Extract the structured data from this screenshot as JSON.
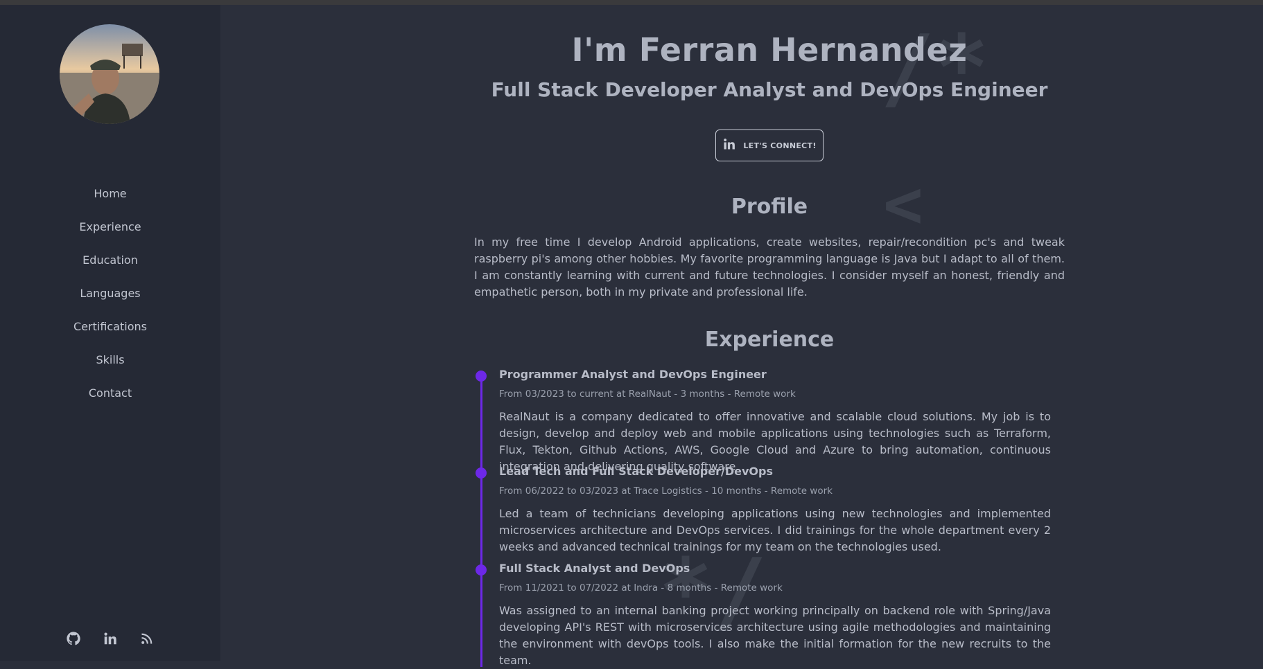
{
  "sidebar": {
    "avatar_alt": "profile photo",
    "nav": [
      "Home",
      "Experience",
      "Education",
      "Languages",
      "Certifications",
      "Skills",
      "Contact"
    ],
    "social_icons": [
      "github-icon",
      "linkedin-icon",
      "rss-icon"
    ]
  },
  "header": {
    "title": "I'm Ferran Hernandez",
    "subtitle": "Full Stack Developer Analyst and DevOps Engineer",
    "connect_label": "LET'S CONNECT!"
  },
  "decorations": {
    "comment_open": "/*",
    "angle": "<",
    "comment_close": "*/"
  },
  "profile": {
    "heading": "Profile",
    "text": "In my free time I develop Android applications, create websites, repair/recondition pc's and tweak raspberry pi's among other hobbies. My favorite programming language is Java but I adapt to all of them. I am constantly learning with current and future technologies. I consider myself an honest, friendly and empathetic person, both in my private and professional life."
  },
  "experience": {
    "heading": "Experience",
    "jobs": [
      {
        "title": "Programmer Analyst and DevOps Engineer",
        "meta": "From 03/2023 to current at RealNaut - 3 months - Remote work",
        "desc": "RealNaut is a company dedicated to offer innovative and scalable cloud solutions. My job is to design, develop and deploy web and mobile applications using technologies such as Terraform, Flux, Tekton, Github Actions, AWS, Google Cloud and Azure to bring automation, continuous integration and delivering quality software."
      },
      {
        "title": "Lead Tech and Full Stack Developer/DevOps",
        "meta": "From 06/2022 to 03/2023 at Trace Logistics - 10 months - Remote work",
        "desc": "Led a team of technicians developing applications using new technologies and implemented microservices architecture and DevOps services. I did trainings for the whole department every 2 weeks and advanced technical trainings for my team on the technologies used."
      },
      {
        "title": "Full Stack Analyst and DevOps",
        "meta": "From 11/2021 to 07/2022 at Indra - 8 months - Remote work",
        "desc": "Was assigned to an internal banking project working principally on backend role with Spring/Java developing API's REST with microservices architecture using agile methodologies and maintaining the environment with devOps tools. I also make the initial formation for the new recruits to the team."
      }
    ]
  },
  "colors": {
    "background": "#2b2f3b",
    "sidebar": "#252935",
    "accent": "#6d28e8",
    "text": "#b8bcc8"
  }
}
